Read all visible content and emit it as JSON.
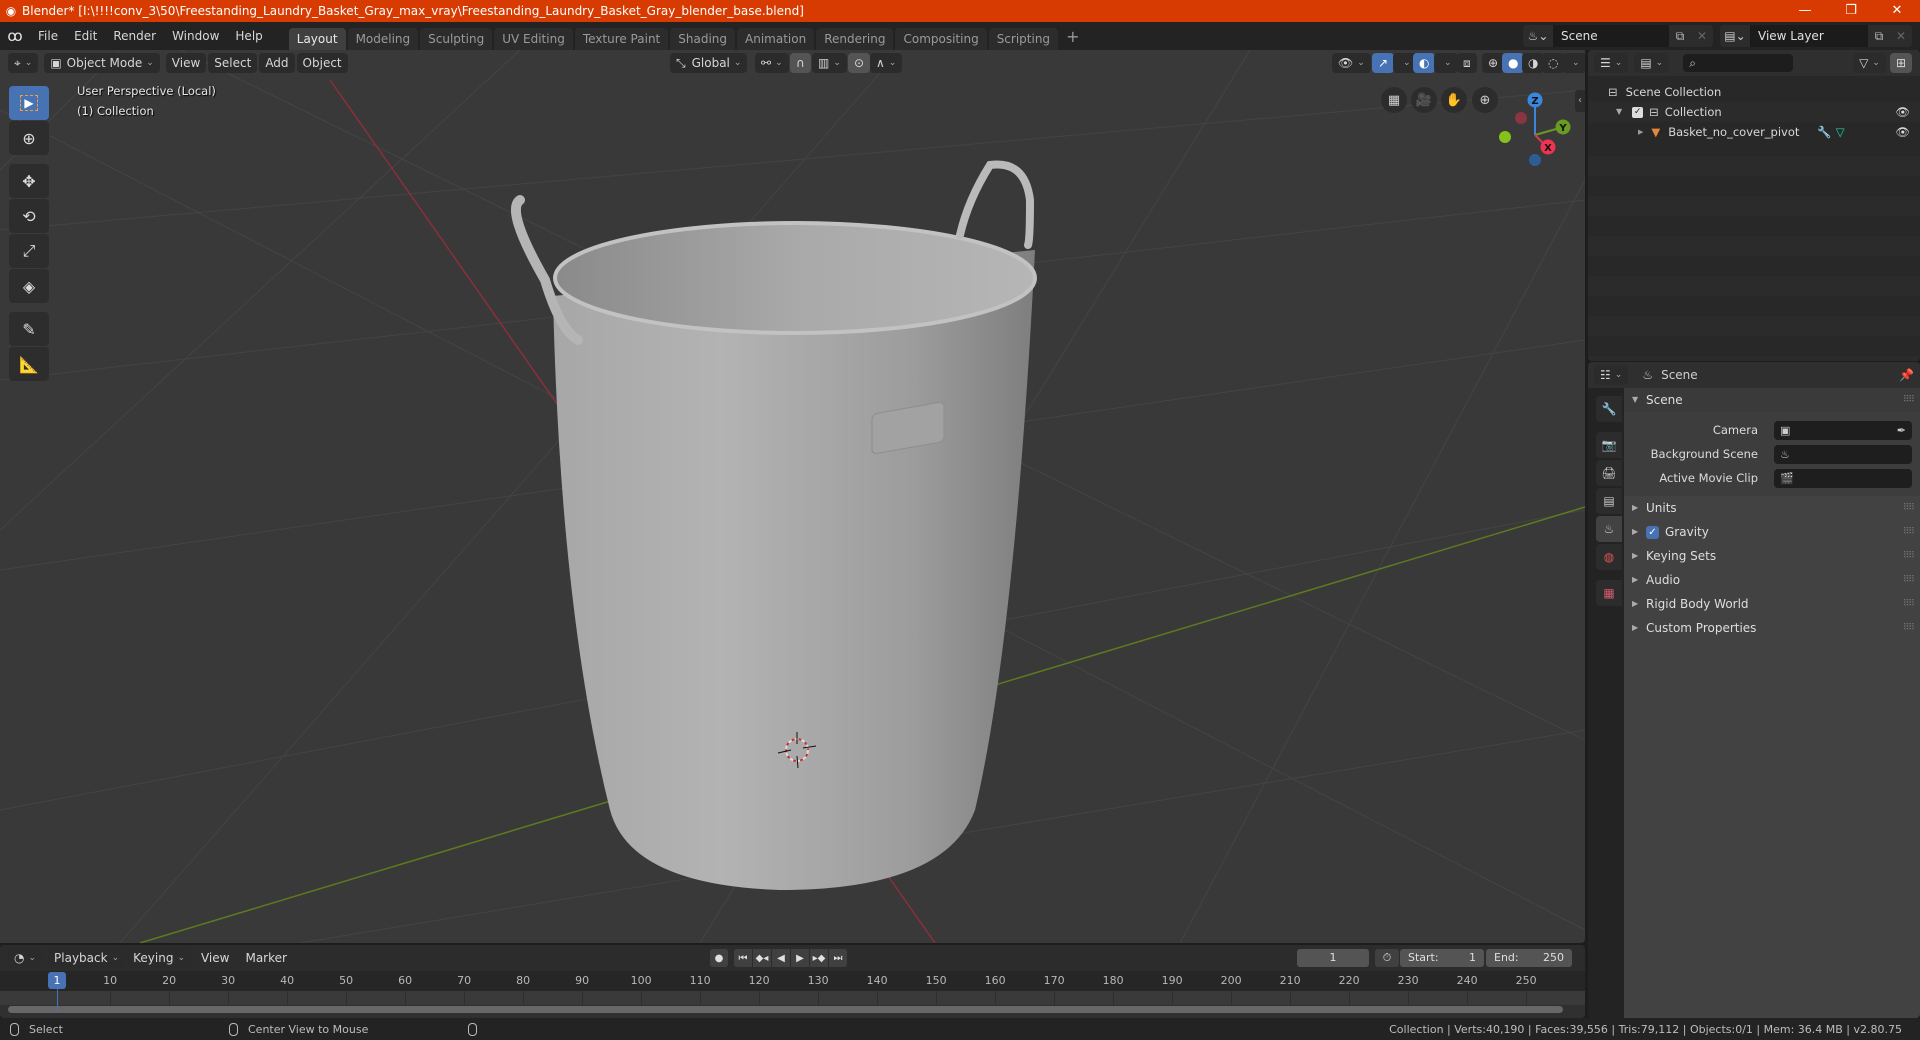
{
  "window": {
    "title": "Blender* [I:\\!!!!conv_3\\50\\Freestanding_Laundry_Basket_Gray_max_vray\\Freestanding_Laundry_Basket_Gray_blender_base.blend]",
    "minimize": "—",
    "maximize": "❐",
    "close": "✕"
  },
  "menu": [
    "File",
    "Edit",
    "Render",
    "Window",
    "Help"
  ],
  "workspaces": [
    {
      "label": "Layout",
      "active": true
    },
    {
      "label": "Modeling"
    },
    {
      "label": "Sculpting"
    },
    {
      "label": "UV Editing"
    },
    {
      "label": "Texture Paint"
    },
    {
      "label": "Shading"
    },
    {
      "label": "Animation"
    },
    {
      "label": "Rendering"
    },
    {
      "label": "Compositing"
    },
    {
      "label": "Scripting"
    }
  ],
  "workspace_add": "+",
  "scene_selector": {
    "value": "Scene"
  },
  "view_layer_selector": {
    "value": "View Layer"
  },
  "viewport": {
    "mode": "Object Mode",
    "menus": [
      "View",
      "Select",
      "Add",
      "Object"
    ],
    "transform_orientation": "Global",
    "overlay_line1": "User Perspective (Local)",
    "overlay_line2": "(1) Collection",
    "gizmo_axes": {
      "x": "X",
      "y": "Y",
      "z": "Z"
    },
    "colors": {
      "x_axis": "#d13d4f",
      "y_axis": "#6b9a23",
      "z_axis": "#3a88de",
      "active_blue": "#4772b3"
    }
  },
  "outliner": {
    "items": [
      {
        "label": "Scene Collection",
        "level": 0
      },
      {
        "label": "Collection",
        "level": 1,
        "checked": true
      },
      {
        "label": "Basket_no_cover_pivot",
        "level": 2
      }
    ]
  },
  "properties": {
    "context": "Scene",
    "panel_scene": {
      "title": "Scene",
      "camera_label": "Camera",
      "background_scene_label": "Background Scene",
      "active_movie_clip_label": "Active Movie Clip"
    },
    "panels": [
      {
        "label": "Units"
      },
      {
        "label": "Gravity",
        "checkbox": true
      },
      {
        "label": "Keying Sets"
      },
      {
        "label": "Audio"
      },
      {
        "label": "Rigid Body World"
      },
      {
        "label": "Custom Properties"
      }
    ]
  },
  "timeline": {
    "menus": [
      "Playback",
      "Keying",
      "View",
      "Marker"
    ],
    "current_frame": "1",
    "start_label": "Start:",
    "start": "1",
    "end_label": "End:",
    "end": "250",
    "ticks": [
      "10",
      "20",
      "30",
      "40",
      "50",
      "60",
      "70",
      "80",
      "90",
      "100",
      "110",
      "120",
      "130",
      "140",
      "150",
      "160",
      "170",
      "180",
      "190",
      "200",
      "210",
      "220",
      "230",
      "240",
      "250"
    ]
  },
  "statusbar": {
    "left_action": "Select",
    "middle_action": "Center View to Mouse",
    "stats": "Collection | Verts:40,190 | Faces:39,556 | Tris:79,112 | Objects:0/1 | Mem: 36.4 MB | v2.80.75"
  }
}
